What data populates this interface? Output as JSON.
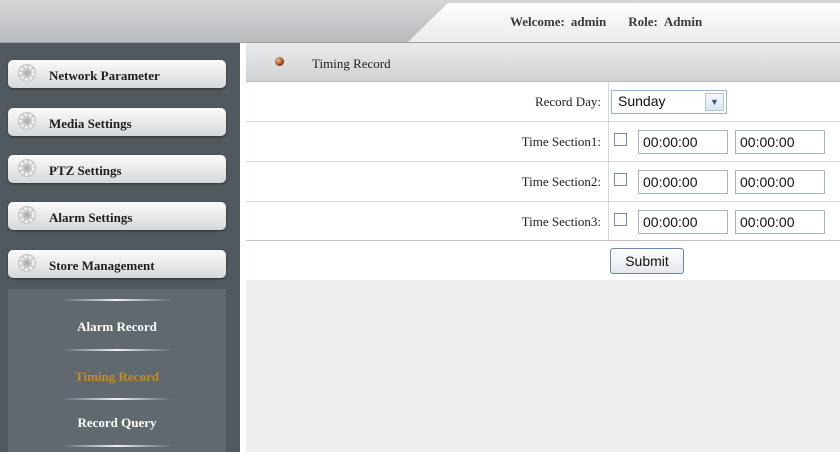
{
  "header": {
    "welcome_label": "Welcome:",
    "user": "admin",
    "role_label": "Role:",
    "role": "Admin"
  },
  "sidebar": {
    "menu": [
      {
        "label": "Network Parameter",
        "icon": "gear-icon"
      },
      {
        "label": "Media Settings",
        "icon": "gear-icon"
      },
      {
        "label": "PTZ Settings",
        "icon": "gear-icon"
      },
      {
        "label": "Alarm Settings",
        "icon": "gear-icon"
      },
      {
        "label": "Store Management",
        "icon": "gear-icon"
      }
    ],
    "submenu": [
      {
        "label": "Alarm Record",
        "active": false
      },
      {
        "label": "Timing Record",
        "active": true
      },
      {
        "label": "Record Query",
        "active": false
      }
    ]
  },
  "page": {
    "title": "Timing Record",
    "title_icon": "bullet-icon"
  },
  "form": {
    "record_day_label": "Record Day:",
    "record_day_value": "Sunday",
    "sections": [
      {
        "label": "Time Section1:",
        "checked": false,
        "start": "00:00:00",
        "end": "00:00:00"
      },
      {
        "label": "Time Section2:",
        "checked": false,
        "start": "00:00:00",
        "end": "00:00:00"
      },
      {
        "label": "Time Section3:",
        "checked": false,
        "start": "00:00:00",
        "end": "00:00:00"
      }
    ],
    "submit_label": "Submit"
  },
  "colors": {
    "sidebar_bg": "#50595f",
    "active_submenu": "#c28c22",
    "content_bg": "#eeeeee"
  }
}
